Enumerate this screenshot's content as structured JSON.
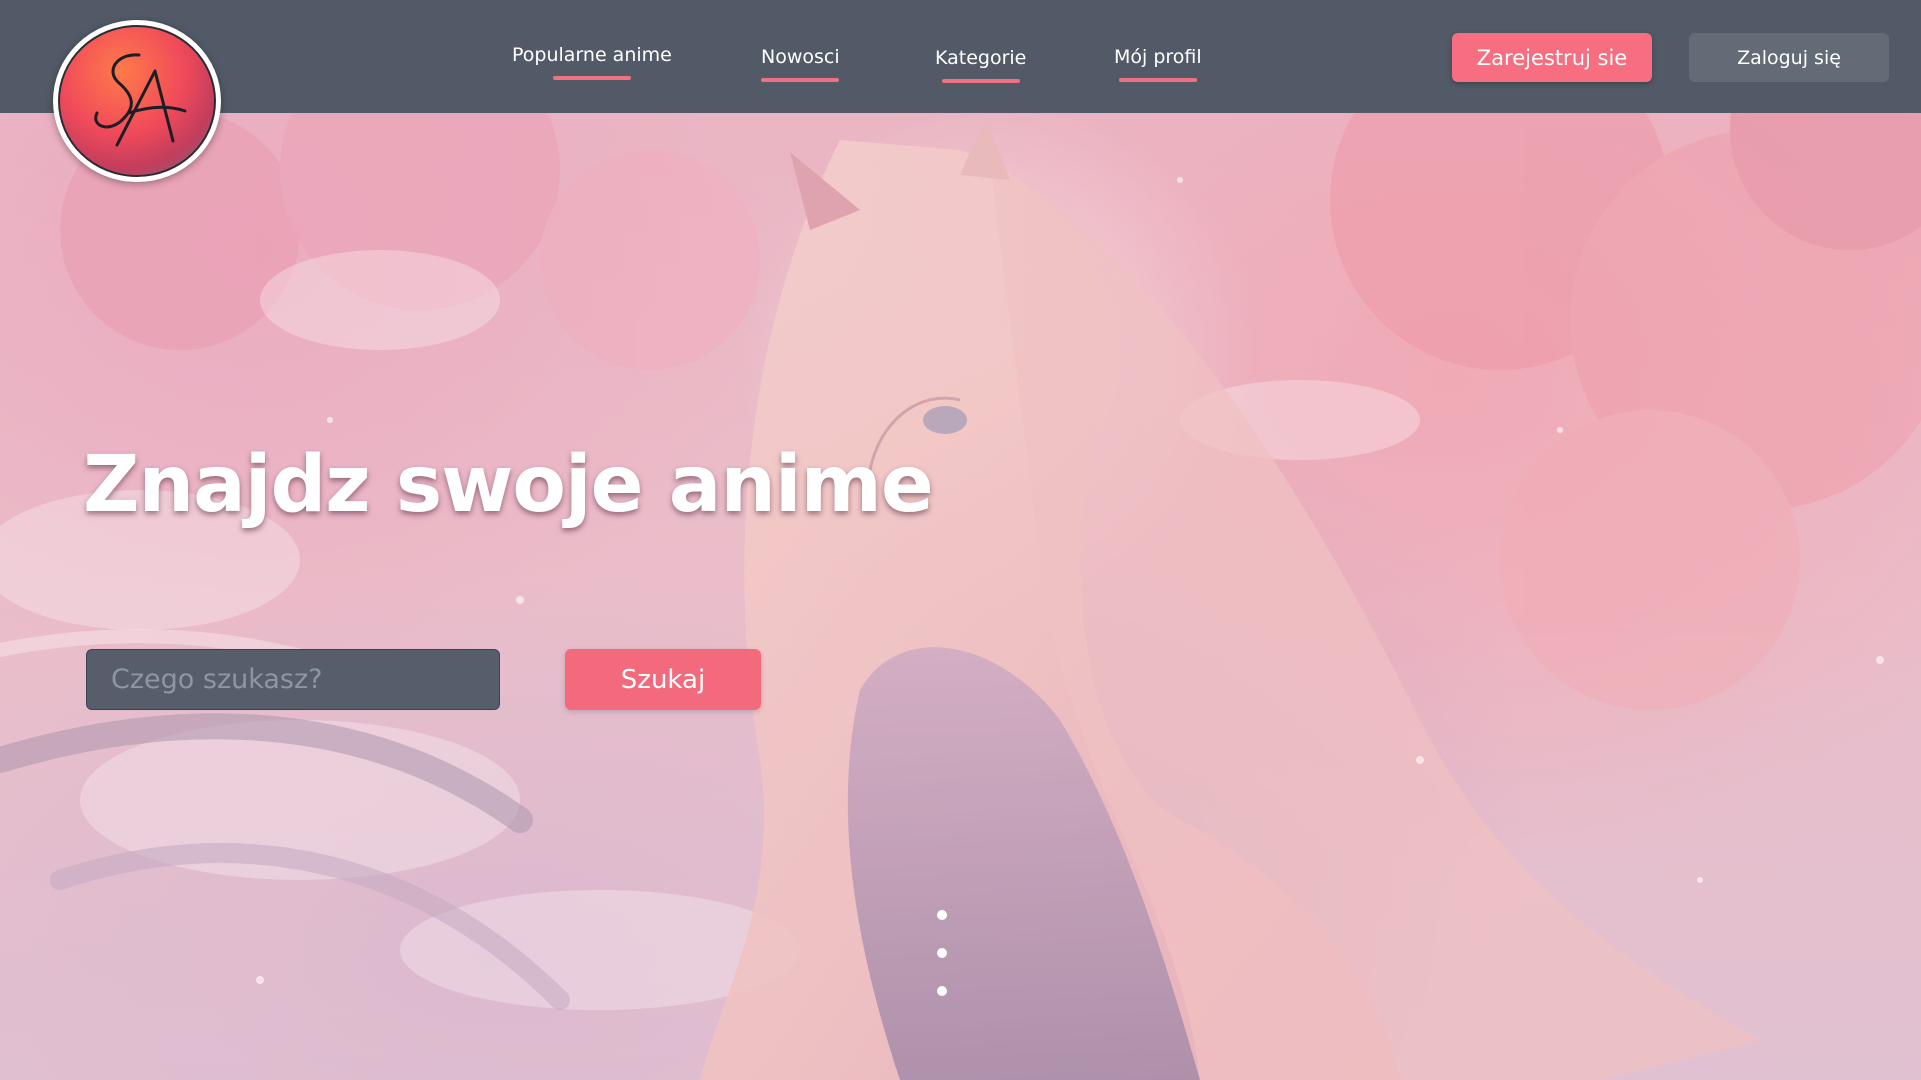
{
  "header": {
    "logo_icon": "sa-monogram-logo",
    "nav": [
      {
        "label": "Popularne anime"
      },
      {
        "label": "Nowosci"
      },
      {
        "label": "Kategorie"
      },
      {
        "label": "Mój profil"
      }
    ],
    "register_label": "Zarejestruj sie",
    "login_label": "Zaloguj się"
  },
  "hero": {
    "title": "Znajdz swoje anime",
    "search": {
      "placeholder": "Czego szukasz?",
      "value": "",
      "button_label": "Szukaj"
    },
    "carousel_dots": 3
  },
  "colors": {
    "header_bg": "#525a68",
    "accent": "#f36a7d",
    "login_bg": "#636b77",
    "input_bg": "#565d6b"
  }
}
